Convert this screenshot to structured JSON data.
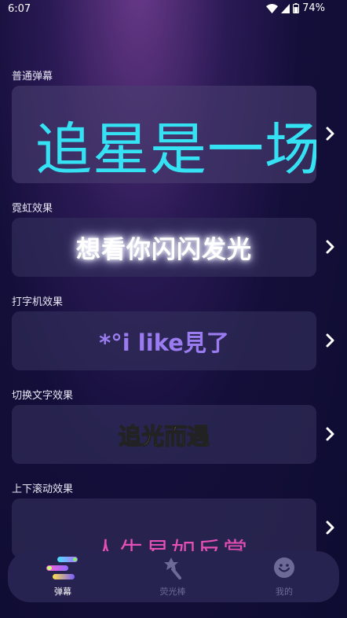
{
  "status_bar": {
    "time": "6:07",
    "battery": "74%"
  },
  "sections": [
    {
      "label": "普通弹幕",
      "preview_text": "追星是一场"
    },
    {
      "label": "霓虹效果",
      "preview_text": "想看你闪闪发光"
    },
    {
      "label": "打字机效果",
      "preview_text": "*°i like見了"
    },
    {
      "label": "切换文字效果",
      "preview_text": "追光而遇"
    },
    {
      "label": "上下滚动效果",
      "preview_text": "人生易如反掌"
    }
  ],
  "bottom_nav": {
    "items": [
      {
        "label": "弹幕",
        "icon": "danmaku-icon",
        "active": true
      },
      {
        "label": "荧光棒",
        "icon": "glow-stick-icon",
        "active": false
      },
      {
        "label": "我的",
        "icon": "smiley-profile-icon",
        "active": false
      }
    ]
  },
  "colors": {
    "accent_cyan": "#35e2f3",
    "typewriter_purple": "#9a7cf0",
    "switch_yellow": "#d8d05a",
    "scroll_pink": "#e64fb5",
    "nav_bg": "#262350"
  }
}
